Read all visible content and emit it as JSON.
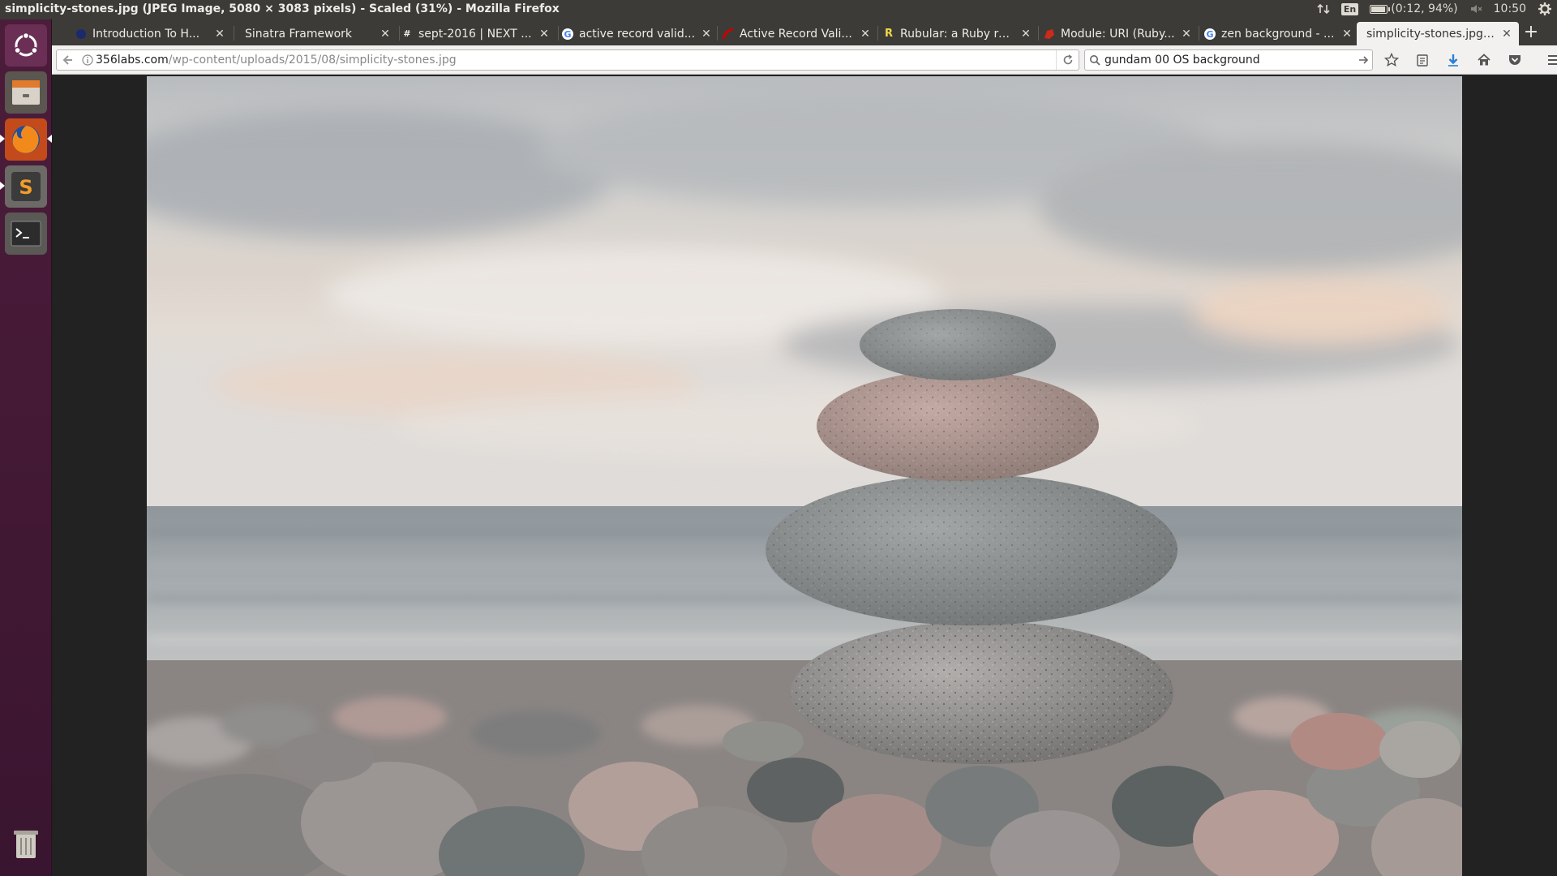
{
  "window": {
    "title": "simplicity-stones.jpg (JPEG Image, 5080 × 3083 pixels) - Scaled (31%) - Mozilla Firefox"
  },
  "system": {
    "keyboard_layout": "En",
    "battery": "(0:12, 94%)",
    "battery_level": 0.94,
    "clock": "10:50"
  },
  "launcher": {
    "items": [
      {
        "name": "ubuntu-dash-icon"
      },
      {
        "name": "files-icon"
      },
      {
        "name": "firefox-icon"
      },
      {
        "name": "sublime-text-icon"
      },
      {
        "name": "terminal-icon"
      },
      {
        "name": "trash-icon"
      }
    ]
  },
  "tabs": [
    {
      "label": "Introduction To H...",
      "favicon": "dark-circle"
    },
    {
      "label": "Sinatra Framework",
      "favicon": ""
    },
    {
      "label": "sept-2016 | NEXT ...",
      "favicon": "#"
    },
    {
      "label": "active record valid...",
      "favicon": "G"
    },
    {
      "label": "Active Record Vali...",
      "favicon": "rails"
    },
    {
      "label": "Rubular: a Ruby re...",
      "favicon": "R"
    },
    {
      "label": "Module: URI (Ruby...",
      "favicon": "ruby"
    },
    {
      "label": "zen background - ...",
      "favicon": "G"
    },
    {
      "label": "simplicity-stones.jpg ...",
      "favicon": ""
    }
  ],
  "navbar": {
    "url_host": "356labs.com",
    "url_path": "/wp-content/uploads/2015/08/simplicity-stones.jpg",
    "search_value": "gundam 00 OS background"
  },
  "colors": {
    "launcher_bg": "#4c1d3b",
    "chrome_dark": "#3c3b37",
    "toolbar_light": "#f2f1f0",
    "download_accent": "#2a7fd4"
  }
}
